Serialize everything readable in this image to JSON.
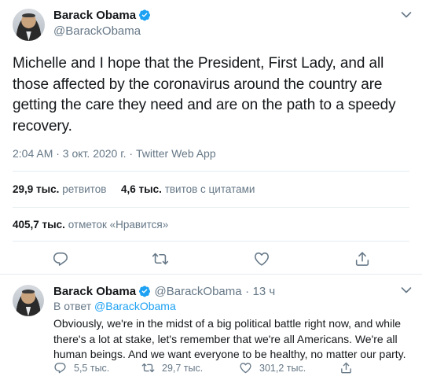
{
  "main_tweet": {
    "author_name": "Barack Obama",
    "author_handle": "@BarackObama",
    "text": "Michelle and I hope that the President, First Lady, and all those affected by the coronavirus around the country are getting the care they need and are on the path to a speedy recovery.",
    "meta": "2:04 AM · 3 окт. 2020 г. · Twitter Web App",
    "retweets_count": "29,9 тыс.",
    "retweets_label": "ретвитов",
    "quotes_count": "4,6 тыс.",
    "quotes_label": "твитов с цитатами",
    "likes_count": "405,7 тыс.",
    "likes_label": "отметок «Нравится»"
  },
  "reply_tweet": {
    "author_name": "Barack Obama",
    "author_handle": "@BarackObama",
    "separator": "·",
    "time": "13 ч",
    "reply_prefix": "В ответ",
    "reply_to": "@BarackObama",
    "text": "Obviously, we're in the midst of a big political battle right now, and while there's a lot at stake, let's remember that we're all Americans. We're all human beings. And we want everyone to be healthy, no matter our party.",
    "replies_count": "5,5 тыс.",
    "retweets_count": "29,7 тыс.",
    "likes_count": "301,2 тыс."
  },
  "colors": {
    "verified": "#1da1f2",
    "secondary_text": "#657786",
    "link": "#1da1f2",
    "icon": "#657786",
    "divider": "#e6ecf0"
  },
  "icons": [
    "verified-badge-icon",
    "chevron-down-icon",
    "reply-icon",
    "retweet-icon",
    "like-icon",
    "share-icon"
  ]
}
